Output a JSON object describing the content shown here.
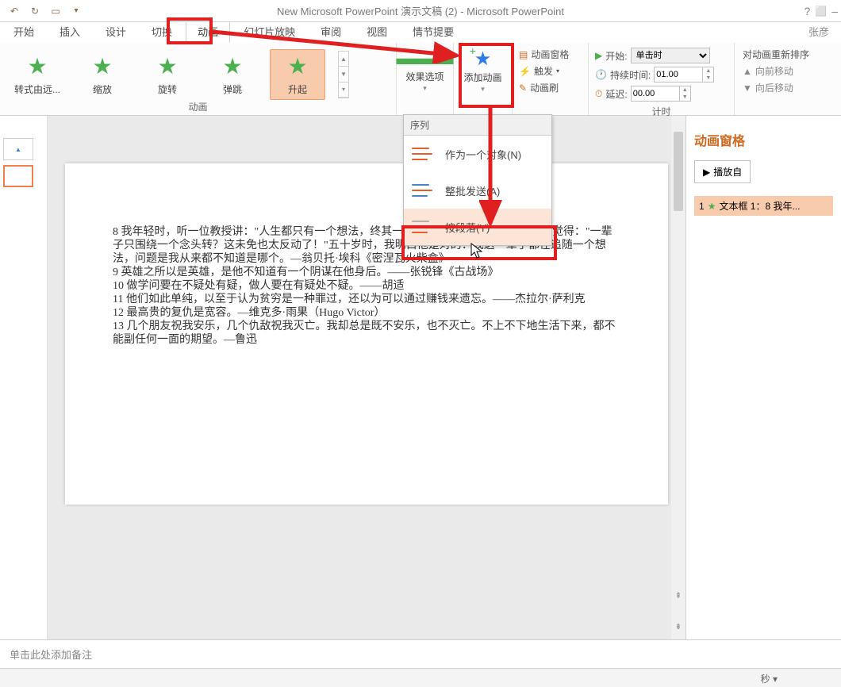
{
  "title": "New Microsoft PowerPoint 演示文稿 (2) - Microsoft PowerPoint",
  "user": "张彦",
  "tabs": {
    "start": "开始",
    "insert": "插入",
    "design": "设计",
    "transitions": "切换",
    "animations": "动画",
    "slideshow": "幻灯片放映",
    "review": "审阅",
    "view": "视图",
    "plot": "情节提要"
  },
  "anim_gallery": {
    "zoom_far": "转式由远...",
    "zoom": "缩放",
    "spin": "旋转",
    "bounce": "弹跳",
    "rise": "升起"
  },
  "anim_group_label": "动画",
  "effect_options": "效果选项",
  "add_animation": "添加动画",
  "anim_pane_btn": "动画窗格",
  "trigger": "触发",
  "anim_painter": "动画刷",
  "timing": {
    "start_label": "开始:",
    "start_value": "单击时",
    "duration_label": "持续时间:",
    "duration_value": "01.00",
    "delay_label": "延迟:",
    "delay_value": "00.00",
    "group_label": "计时"
  },
  "reorder": {
    "title": "对动画重新排序",
    "fwd": "向前移动",
    "back": "向后移动"
  },
  "dropdown": {
    "header": "序列",
    "opt1": "作为一个对象(N)",
    "opt2": "整批发送(A)",
    "opt3": "按段落(Y)"
  },
  "slide_text": "8 我年轻时，听一位教授讲：\"人生都只有一个想法，终其一生不过是不断丰富它。\"我当时觉得：\"一辈子只围绕一个念头转？这未免也太反动了！\"五十岁时，我明白他是对的：我这一辈子都在追随一个想法，问题是我从来都不知道是哪个。—翁贝托·埃科《密涅瓦火柴盒》\n9 英雄之所以是英雄，是他不知道有一个阴谋在他身后。——张锐锋《古战场》\n10 做学问要在不疑处有疑，做人要在有疑处不疑。——胡适\n11 他们如此单纯，以至于认为贫穷是一种罪过，还以为可以通过赚钱来遗忘。——杰拉尔·萨利克\n12 最高贵的复仇是宽容。—维克多·雨果（Hugo Victor）\n13 几个朋友祝我安乐，几个仇敌祝我灭亡。我却总是既不安乐，也不灭亡。不上不下地生活下来，都不能副任何一面的期望。—鲁迅",
  "anim_pane": {
    "title": "动画窗格",
    "play": "播放自",
    "item": "文本框 1：8 我年..."
  },
  "notes_placeholder": "单击此处添加备注",
  "status_sec": "秒",
  "title_icons": {
    "help": "?",
    "full": "⬜"
  }
}
